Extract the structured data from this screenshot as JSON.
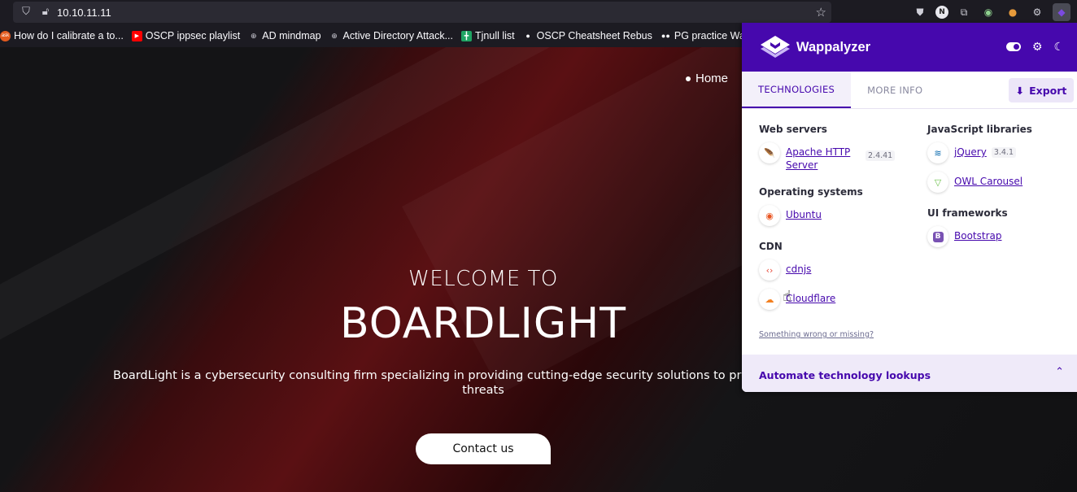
{
  "browser": {
    "url": "10.10.11.11",
    "bookmarks": [
      {
        "label": "How do I calibrate a to...",
        "icon": "ask-icon",
        "color": "#e35b1e"
      },
      {
        "label": "OSCP ippsec playlist",
        "icon": "youtube-icon",
        "color": "#ff0000"
      },
      {
        "label": "AD mindmap",
        "icon": "globe-icon",
        "color": "#cfcfd8"
      },
      {
        "label": "Active Directory Attack...",
        "icon": "globe-icon",
        "color": "#cfcfd8"
      },
      {
        "label": "Tjnull list",
        "icon": "sheets-icon",
        "color": "#1fa463"
      },
      {
        "label": "OSCP Cheatsheet Rebus",
        "icon": "github-icon",
        "color": "#fbfbfe"
      },
      {
        "label": "PG practice Walk",
        "icon": "medium-icon",
        "color": "#fbfbfe"
      }
    ]
  },
  "page": {
    "nav_home": "Home",
    "welcome": "WELCOME TO",
    "title": "BOARDLIGHT",
    "description": "BoardLight is a cybersecurity consulting firm specializing in providing cutting-edge security solutions to protect your",
    "description_cont": "threats",
    "contact_button": "Contact us"
  },
  "wappalyzer": {
    "brand": "Wappalyzer",
    "tabs": [
      "TECHNOLOGIES",
      "MORE INFO"
    ],
    "export_label": "Export",
    "left_categories": [
      {
        "name": "Web servers",
        "techs": [
          {
            "name": "Apache HTTP Server",
            "version": "2.4.41",
            "icon": "apache-feather-icon"
          }
        ]
      },
      {
        "name": "Operating systems",
        "techs": [
          {
            "name": "Ubuntu",
            "version": "",
            "icon": "ubuntu-icon"
          }
        ]
      },
      {
        "name": "CDN",
        "techs": [
          {
            "name": "cdnjs",
            "version": "",
            "icon": "cdnjs-icon"
          },
          {
            "name": "Cloudflare",
            "version": "",
            "icon": "cloudflare-icon"
          }
        ]
      }
    ],
    "right_categories": [
      {
        "name": "JavaScript libraries",
        "techs": [
          {
            "name": "jQuery",
            "version": "3.4.1",
            "icon": "jquery-icon"
          },
          {
            "name": "OWL Carousel",
            "version": "",
            "icon": "owl-carousel-icon"
          }
        ]
      },
      {
        "name": "UI frameworks",
        "techs": [
          {
            "name": "Bootstrap",
            "version": "",
            "icon": "bootstrap-icon"
          }
        ]
      }
    ],
    "something_wrong": "Something wrong or missing?",
    "automate_title": "Automate technology lookups",
    "accent": "#4608ad"
  }
}
